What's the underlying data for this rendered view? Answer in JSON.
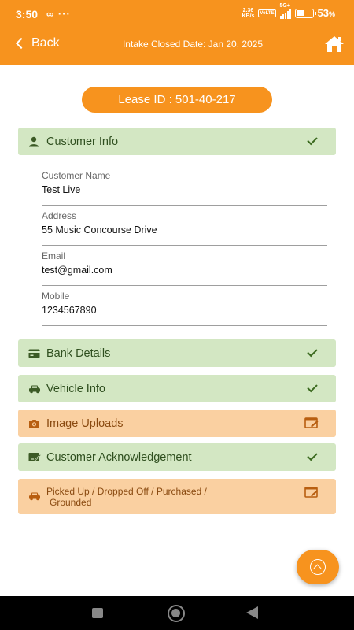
{
  "status_bar": {
    "time": "3:50",
    "extra_icons": "∞ ···",
    "net_speed_value": "2.36",
    "net_speed_unit": "KB/s",
    "volte": "VoLTE",
    "network": "5G+",
    "battery_percent": "53",
    "battery_level": 0.53,
    "percent_sign": "%"
  },
  "header": {
    "back_label": "Back",
    "intake_date": "Intake Closed Date: Jan 20, 2025",
    "home_icon": "home-icon"
  },
  "lease": {
    "label": "Lease ID : 501-40-217"
  },
  "sections": {
    "customer_info": {
      "label": "Customer Info",
      "icon": "person-icon",
      "status": "check"
    },
    "bank_details": {
      "label": "Bank Details",
      "icon": "credit-card-icon",
      "status": "check"
    },
    "vehicle_info": {
      "label": "Vehicle Info",
      "icon": "car-icon",
      "status": "check"
    },
    "image_uploads": {
      "label": "Image Uploads",
      "icon": "camera-icon",
      "status": "edit"
    },
    "customer_ack": {
      "label": "Customer Acknowledgement",
      "icon": "signature-icon",
      "status": "check"
    },
    "picked_up": {
      "label_line1": "Picked Up / Dropped Off / Purchased /",
      "label_line2": "Grounded",
      "icon": "car-icon",
      "status": "edit"
    }
  },
  "customer_fields": [
    {
      "label": "Customer Name",
      "value": "Test Live"
    },
    {
      "label": "Address",
      "value": "55 Music Concourse Drive"
    },
    {
      "label": "Email",
      "value": "test@gmail.com"
    },
    {
      "label": "Mobile",
      "value": "1234567890"
    }
  ],
  "colors": {
    "brand_orange": "#f7931e",
    "complete_green": "#d3e7c3",
    "pending_orange": "#fad0a1"
  }
}
